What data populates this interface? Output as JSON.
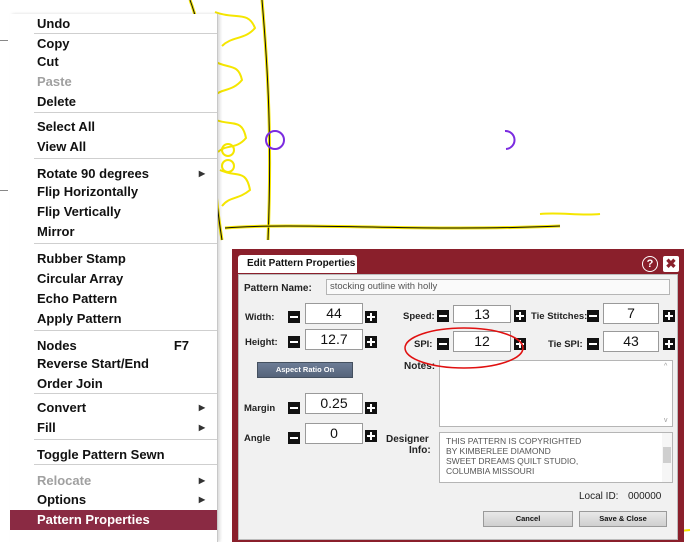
{
  "colors": {
    "accent": "#8a1f2b",
    "selected_menu": "#8a2a43",
    "pattern_line": "#f5e600",
    "circle": "#7b2be0",
    "annotation": "#e01010"
  },
  "menu": {
    "items": [
      {
        "label": "Undo"
      },
      {
        "label": "Copy"
      },
      {
        "label": "Cut"
      },
      {
        "label": "Paste",
        "disabled": true
      },
      {
        "label": "Delete"
      },
      {
        "label": "Select All"
      },
      {
        "label": "View All"
      },
      {
        "label": "Rotate 90 degrees",
        "submenu": true
      },
      {
        "label": "Flip Horizontally"
      },
      {
        "label": "Flip Vertically"
      },
      {
        "label": "Mirror"
      },
      {
        "label": "Rubber Stamp"
      },
      {
        "label": "Circular Array"
      },
      {
        "label": "Echo Pattern"
      },
      {
        "label": "Apply Pattern"
      },
      {
        "label": "Nodes",
        "shortcut": "F7"
      },
      {
        "label": "Reverse Start/End"
      },
      {
        "label": "Order Join"
      },
      {
        "label": "Convert",
        "submenu": true
      },
      {
        "label": "Fill",
        "submenu": true
      },
      {
        "label": "Toggle Pattern Sewn"
      },
      {
        "label": "Relocate",
        "disabled": true,
        "submenu": true
      },
      {
        "label": "Options",
        "submenu": true
      },
      {
        "label": "Pattern Properties",
        "selected": true
      }
    ]
  },
  "dialog": {
    "title": "Edit Pattern Properties",
    "help_icon": "question-circle-icon",
    "close_icon": "close-x-icon",
    "pattern_name_label": "Pattern Name:",
    "pattern_name_value": "stocking outline with holly",
    "width_label": "Width:",
    "width_value": "44",
    "height_label": "Height:",
    "height_value": "12.7",
    "aspect_button": "Aspect Ratio On",
    "margin_label": "Margin",
    "margin_value": "0.25",
    "angle_label": "Angle",
    "angle_value": "0",
    "speed_label": "Speed:",
    "speed_value": "13",
    "spi_label": "SPI:",
    "spi_value": "12",
    "tie_stitches_label": "Tie Stitches:",
    "tie_stitches_value": "7",
    "tie_spi_label": "Tie SPI:",
    "tie_spi_value": "43",
    "notes_label": "Notes:",
    "notes_value": "",
    "designer_label_1": "Designer",
    "designer_label_2": "Info:",
    "designer_lines": [
      "THIS PATTERN IS COPYRIGHTED",
      "BY KIMBERLEE DIAMOND",
      "SWEET DREAMS QUILT STUDIO,",
      "COLUMBIA MISSOURI"
    ],
    "local_id_label": "Local ID:",
    "local_id_value": "000000",
    "cancel_label": "Cancel",
    "save_label": "Save & Close"
  }
}
